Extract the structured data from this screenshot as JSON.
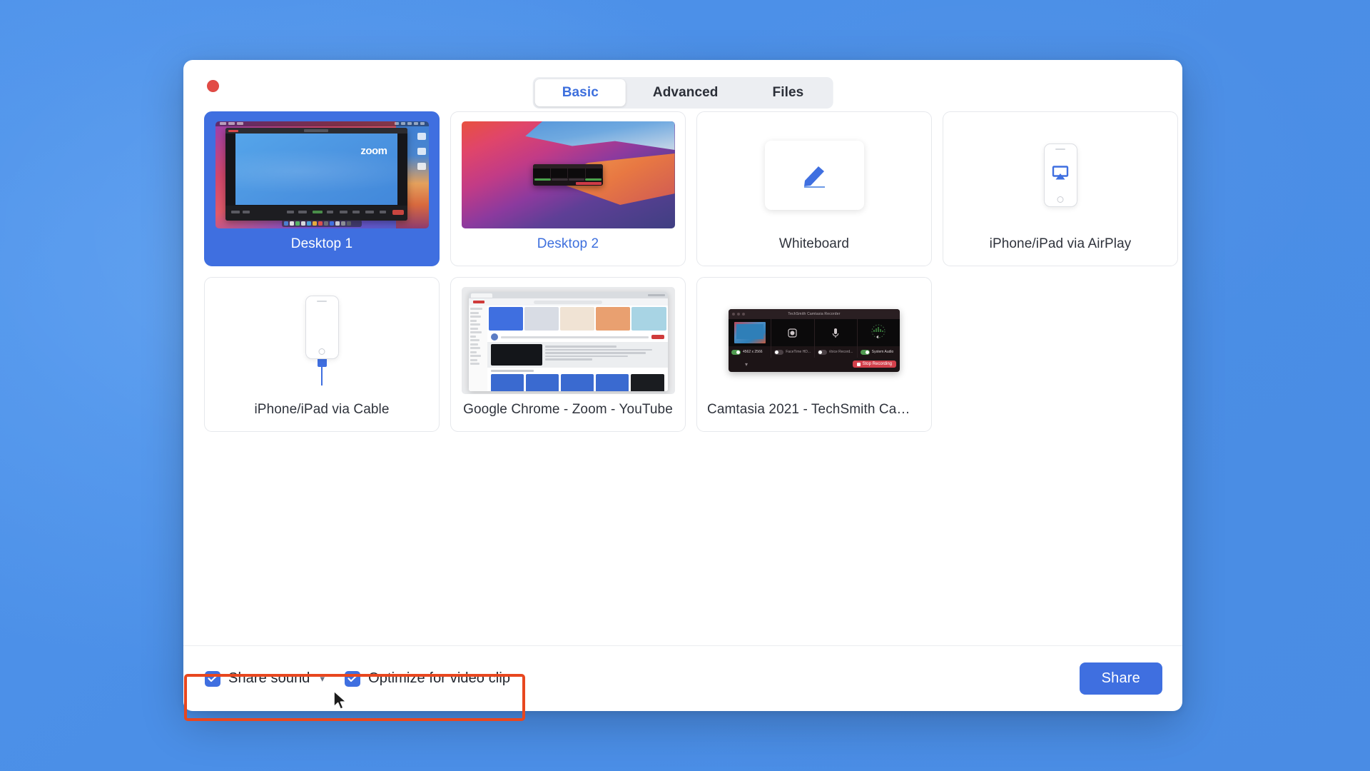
{
  "window": {
    "close_button": "close",
    "tabs": [
      {
        "label": "Basic",
        "active": true
      },
      {
        "label": "Advanced",
        "active": false
      },
      {
        "label": "Files",
        "active": false
      }
    ]
  },
  "share_sources": [
    {
      "label": "Desktop 1",
      "state": "selected",
      "thumb": "desktop1-zoom-meeting"
    },
    {
      "label": "Desktop 2",
      "state": "hovered",
      "thumb": "desktop2-bigsur-recorder"
    },
    {
      "label": "Whiteboard",
      "state": "normal",
      "thumb": "whiteboard-pen-icon"
    },
    {
      "label": "iPhone/iPad via AirPlay",
      "state": "normal",
      "thumb": "phone-airplay-icon"
    },
    {
      "label": "iPhone/iPad via Cable",
      "state": "normal",
      "thumb": "phone-cable-icon"
    },
    {
      "label": "Google Chrome - Zoom - YouTube",
      "state": "normal",
      "thumb": "chrome-youtube-window"
    },
    {
      "label": "Camtasia 2021 - TechSmith Camta...",
      "state": "normal",
      "thumb": "camtasia-recorder-window"
    }
  ],
  "camtasia_thumb": {
    "title": "TechSmith Camtasia Recorder",
    "toggles": [
      {
        "label": "4562 x 2566",
        "on": true
      },
      {
        "label": "FaceTime HD...",
        "on": false
      },
      {
        "label": "Voice Record...",
        "on": false
      },
      {
        "label": "System Audio",
        "on": true
      }
    ],
    "stop_button": "Stop Recording"
  },
  "desktop1_thumb": {
    "logo": "zoom"
  },
  "footer": {
    "share_sound": {
      "label": "Share sound",
      "checked": true,
      "has_dropdown": true
    },
    "optimize": {
      "label": "Optimize for video clip",
      "checked": true
    },
    "share_button": "Share"
  },
  "annotation": {
    "type": "highlight-rectangle",
    "color": "#e8471f"
  },
  "colors": {
    "accent_blue": "#3f6fe0",
    "tab_active_text": "#3d6fdd",
    "close_red": "#e24b45",
    "annotation_red": "#e8471f",
    "desktop_background": "#4b8fe7"
  }
}
